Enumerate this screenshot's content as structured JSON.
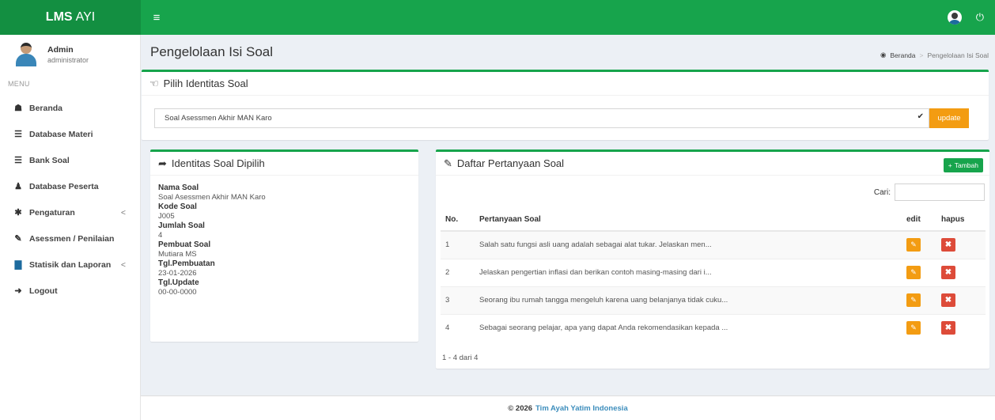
{
  "header": {
    "brand_bold": "LMS",
    "brand_rest": "AYI",
    "toggle_icon": "≡"
  },
  "sidebar": {
    "user_name": "Admin",
    "user_role": "administrator",
    "menu_header": "MENU",
    "items": [
      {
        "label": "Beranda",
        "icon": "home-icon"
      },
      {
        "label": "Database Materi",
        "icon": "database-icon"
      },
      {
        "label": "Bank Soal",
        "icon": "database-icon"
      },
      {
        "label": "Database Peserta",
        "icon": "users-icon"
      },
      {
        "label": "Pengaturan",
        "icon": "gear-icon",
        "arrow": "<"
      },
      {
        "label": "Asessmen / Penilaian",
        "icon": "edit-icon"
      },
      {
        "label": "Statisik dan Laporan",
        "icon": "bar-chart-icon",
        "arrow": "<"
      },
      {
        "label": "Logout",
        "icon": "sign-out-icon"
      }
    ]
  },
  "page": {
    "title": "Pengelolaan Isi Soal",
    "breadcrumb_home": "Beranda",
    "breadcrumb_sep": ">",
    "breadcrumb_current": "Pengelolaan Isi Soal"
  },
  "select_box": {
    "title": "Pilih Identitas Soal",
    "selected": "Soal Asessmen Akhir MAN Karo",
    "update_label": "update"
  },
  "identity_box": {
    "title": "Identitas Soal Dipilih",
    "fields": [
      {
        "label": "Nama Soal",
        "value": "Soal Asessmen Akhir MAN Karo"
      },
      {
        "label": "Kode Soal",
        "value": "J005"
      },
      {
        "label": "Jumlah Soal",
        "value": "4"
      },
      {
        "label": "Pembuat Soal",
        "value": "Mutiara MS"
      },
      {
        "label": "Tgl.Pembuatan",
        "value": "23-01-2026"
      },
      {
        "label": "Tgl.Update",
        "value": "00-00-0000"
      }
    ]
  },
  "questions_box": {
    "title": "Daftar Pertanyaan Soal",
    "add_label": "Tambah",
    "search_label": "Cari:",
    "search_value": "",
    "columns": [
      "No.",
      "Pertanyaan Soal",
      "edit",
      "hapus"
    ],
    "rows": [
      {
        "no": "1",
        "question": "Salah satu fungsi asli uang adalah sebagai alat tukar. Jelaskan men..."
      },
      {
        "no": "2",
        "question": "Jelaskan pengertian inflasi dan berikan contoh masing-masing dari i..."
      },
      {
        "no": "3",
        "question": "Seorang ibu rumah tangga mengeluh karena uang belanjanya tidak cuku..."
      },
      {
        "no": "4",
        "question": "Sebagai seorang pelajar, apa yang dapat Anda rekomendasikan kepada ..."
      }
    ],
    "pager_text": "1 - 4 dari 4"
  },
  "footer": {
    "prefix": "© 2026",
    "link": "Tim Ayah Yatim Indonesia"
  },
  "colors": {
    "brand": "#17a44c",
    "warning": "#f39c12",
    "danger": "#dd4b39"
  }
}
